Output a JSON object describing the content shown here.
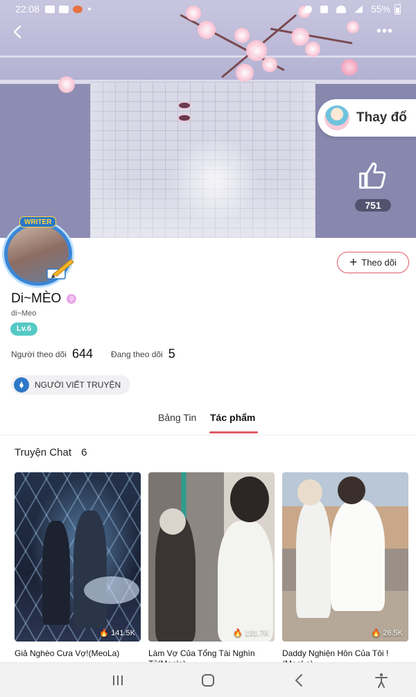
{
  "status_bar": {
    "time": "22:08",
    "battery": "55%"
  },
  "header": {
    "change_cover_label": "Thay đổ",
    "likes": "751"
  },
  "profile": {
    "badge": "WRITER",
    "name": "Di~MÈO",
    "handle": "di~Meo",
    "level": "Lv.6",
    "follow_button": "Theo dõi",
    "followers_label": "Người theo dõi",
    "followers_count": "644",
    "following_label": "Đang theo dõi",
    "following_count": "5",
    "role": "NGƯỜI VIẾT TRUYỆN"
  },
  "tabs": [
    {
      "label": "Bảng Tin",
      "active": false
    },
    {
      "label": "Tác phẩm",
      "active": true
    }
  ],
  "section": {
    "title": "Truyện Chat",
    "count": "6"
  },
  "stories": [
    {
      "title": "Giả Nghèo Cưa Vợ!(MeoLa)",
      "views": "141.5K"
    },
    {
      "title": "Làm Vợ Của Tổng Tài Nghìn Tỷ(Meola)",
      "views": "131.7K"
    },
    {
      "title": "Daddy Nghiện Hôn Của Tôi ! (MeoLa)",
      "views": "26.5K"
    }
  ],
  "colors": {
    "accent": "#e05a66",
    "level_badge": "#56c9c4",
    "writer_blue": "#2e78c7"
  },
  "icons": {
    "back": "chevron-left-icon",
    "more": "more-dots-icon",
    "like": "thumbs-up-icon",
    "views": "flame-icon",
    "nav": [
      "recent-apps-icon",
      "home-icon",
      "back-icon",
      "accessibility-icon"
    ]
  }
}
